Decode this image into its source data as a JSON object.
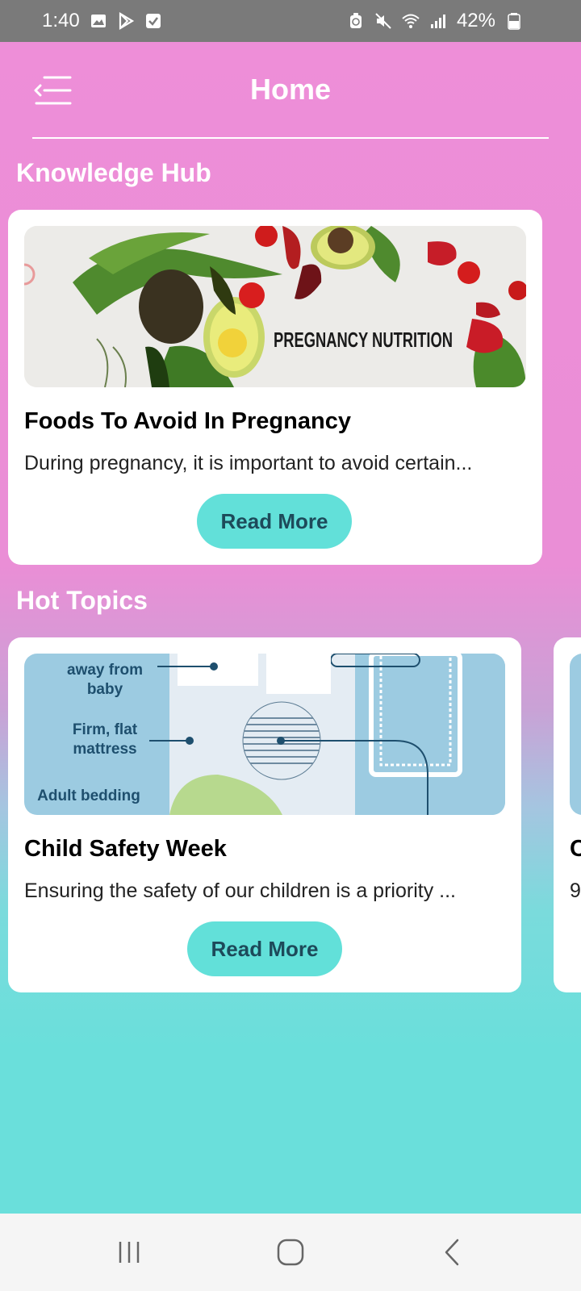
{
  "status_bar": {
    "time": "1:40",
    "battery": "42%"
  },
  "header": {
    "title": "Home",
    "menu_icon": "menu-back-icon"
  },
  "knowledge_hub": {
    "section_title": "Knowledge Hub",
    "cards": [
      {
        "image_text": "PREGNANCY NUTRITION",
        "title": "Foods To Avoid In Pregnancy",
        "description": "During pregnancy, it is important to avoid certain...",
        "button": "Read More"
      }
    ]
  },
  "hot_topics": {
    "section_title": "Hot Topics",
    "cards": [
      {
        "image_labels": [
          "away from",
          "baby",
          "Firm, flat",
          "mattress",
          "Adult bedding"
        ],
        "title": "Child Safety Week",
        "description": "Ensuring the safety of our children is a priority ...",
        "button": "Read More"
      },
      {
        "title": "C",
        "description": "9"
      }
    ]
  },
  "colors": {
    "accent_button": "#62e0d9",
    "button_text": "#1d4a5a",
    "gradient_top": "#ee8ed8",
    "gradient_bottom": "#6adfdb"
  }
}
